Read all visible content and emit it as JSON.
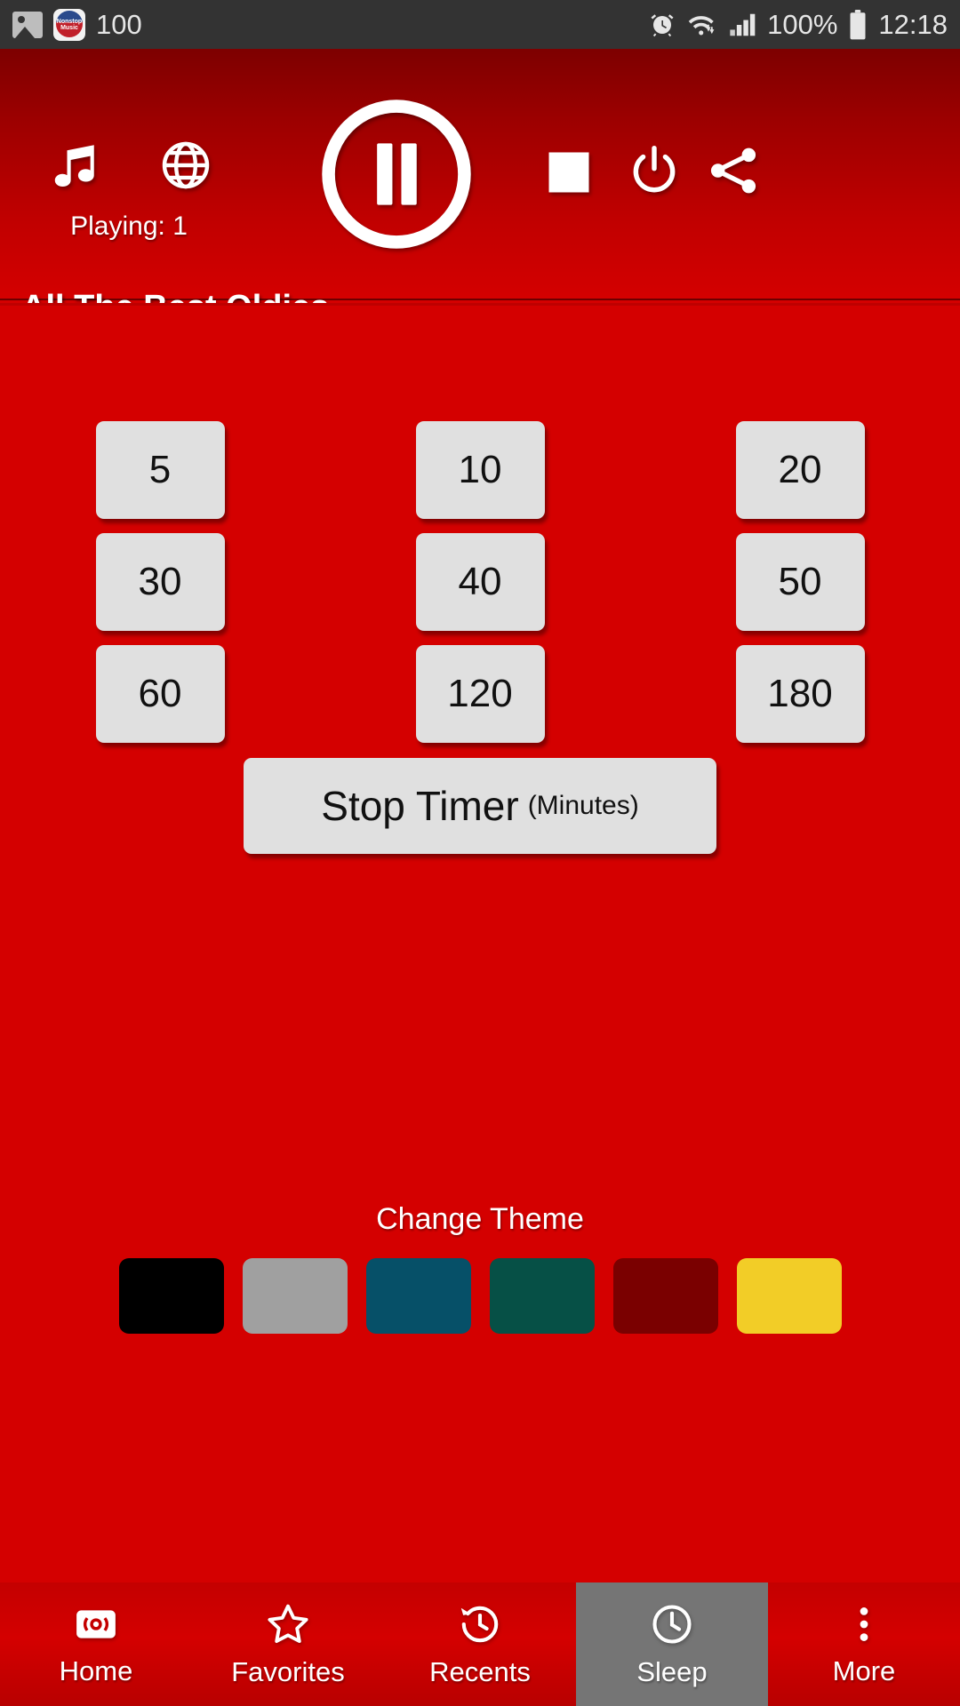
{
  "status_bar": {
    "left_icons": [
      "image-icon",
      "nonstop-music-app-icon"
    ],
    "app_icon_line1": "Nonstop",
    "app_icon_line2": "Music",
    "notification_count": "100",
    "right_icons": [
      "alarm-icon",
      "wifi-icon",
      "signal-icon",
      "battery-icon"
    ],
    "battery_percent": "100%",
    "clock": "12:18"
  },
  "player": {
    "music_icon": "music-note-icon",
    "globe_icon": "globe-icon",
    "play_pause_icon": "pause-icon",
    "stop_icon": "stop-icon",
    "power_icon": "power-icon",
    "share_icon": "share-icon",
    "playing_label": "Playing: 1",
    "station_title": "All The Best Oldies"
  },
  "sleep_timer": {
    "buttons": [
      "5",
      "10",
      "20",
      "30",
      "40",
      "50",
      "60",
      "120",
      "180"
    ],
    "stop_timer_main": "Stop Timer",
    "stop_timer_sub": "(Minutes)"
  },
  "theme": {
    "label": "Change Theme",
    "swatches": [
      {
        "name": "black",
        "color": "#000000"
      },
      {
        "name": "grey",
        "color": "#a0a0a0"
      },
      {
        "name": "teal",
        "color": "#065068"
      },
      {
        "name": "green",
        "color": "#065046"
      },
      {
        "name": "maroon",
        "color": "#7a0000"
      },
      {
        "name": "yellow",
        "color": "#f2cd27"
      }
    ]
  },
  "bottom_nav": {
    "items": [
      {
        "label": "Home",
        "icon": "radio-icon",
        "active": false
      },
      {
        "label": "Favorites",
        "icon": "star-icon",
        "active": false
      },
      {
        "label": "Recents",
        "icon": "history-clock-icon",
        "active": false
      },
      {
        "label": "Sleep",
        "icon": "clock-icon",
        "active": true
      },
      {
        "label": "More",
        "icon": "more-vert-icon",
        "active": false
      }
    ],
    "active_background": "#757575"
  },
  "colors": {
    "app_red": "#d40000",
    "header_dark_red": "#7d0000",
    "button_grey": "#e0e0e0",
    "status_bar": "#333333"
  }
}
